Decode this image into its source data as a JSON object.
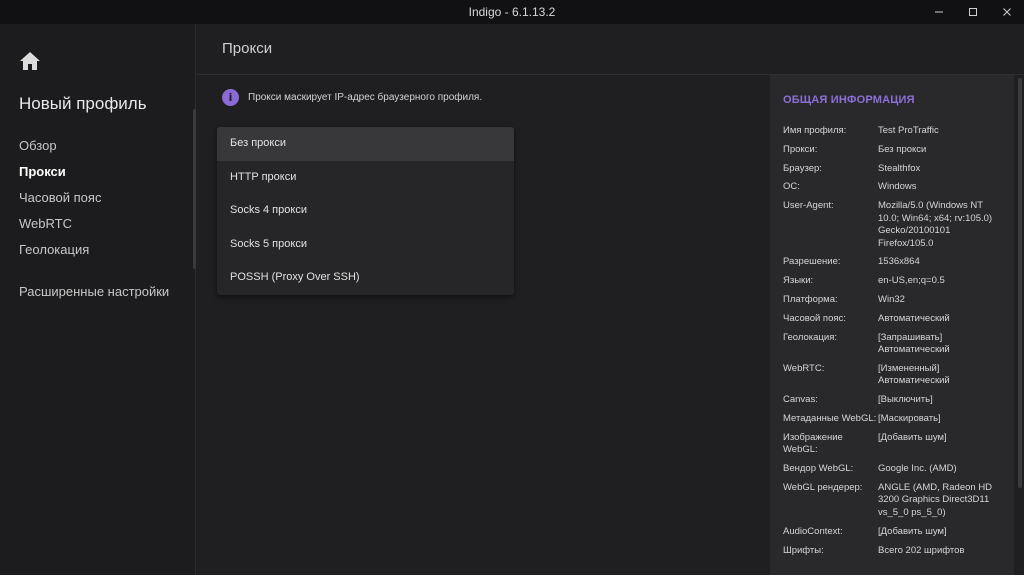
{
  "window": {
    "title": "Indigo - 6.1.13.2"
  },
  "sidebar": {
    "profile_name": "Новый профиль",
    "items": [
      {
        "label": "Обзор"
      },
      {
        "label": "Прокси"
      },
      {
        "label": "Часовой пояс"
      },
      {
        "label": "WebRTC"
      },
      {
        "label": "Геолокация"
      },
      {
        "label": "Расширенные настройки"
      }
    ],
    "active_item": "Прокси"
  },
  "page": {
    "title": "Прокси",
    "notice": "Прокси маскирует IP-адрес браузерного профиля."
  },
  "proxy_dropdown": {
    "selected": "Без прокси",
    "options": [
      "Без прокси",
      "HTTP прокси",
      "Socks 4 прокси",
      "Socks 5 прокси",
      "POSSH (Proxy Over SSH)"
    ]
  },
  "info_panel": {
    "heading": "ОБЩАЯ ИНФОРМАЦИЯ",
    "rows": [
      {
        "key": "Имя профиля:",
        "value": "Test ProTraffic"
      },
      {
        "key": "Прокси:",
        "value": "Без прокси"
      },
      {
        "key": "Браузер:",
        "value": "Stealthfox"
      },
      {
        "key": "ОС:",
        "value": "Windows"
      },
      {
        "key": "User-Agent:",
        "value": "Mozilla/5.0 (Windows NT 10.0; Win64; x64; rv:105.0) Gecko/20100101 Firefox/105.0"
      },
      {
        "key": "Разрешение:",
        "value": "1536x864"
      },
      {
        "key": "Языки:",
        "value": "en-US,en;q=0.5"
      },
      {
        "key": "Платформа:",
        "value": "Win32"
      },
      {
        "key": "Часовой пояс:",
        "value": "Автоматический"
      },
      {
        "key": "Геолокация:",
        "value": "[Запрашивать] Автоматический"
      },
      {
        "key": "WebRTC:",
        "value": "[Измененный] Автоматический"
      },
      {
        "key": "Canvas:",
        "value": "[Выключить]"
      },
      {
        "key": "Метаданные WebGL:",
        "value": "[Маскировать]"
      },
      {
        "key": "Изображение WebGL:",
        "value": "[Добавить шум]"
      },
      {
        "key": "Вендор WebGL:",
        "value": "Google Inc. (AMD)"
      },
      {
        "key": "WebGL рендерер:",
        "value": "ANGLE (AMD, Radeon HD 3200 Graphics Direct3D11 vs_5_0 ps_5_0)"
      },
      {
        "key": "AudioContext:",
        "value": "[Добавить шум]"
      },
      {
        "key": "Шрифты:",
        "value": "Всего 202 шрифтов"
      }
    ]
  },
  "colors": {
    "accent": "#8d6fd8",
    "background": "#1f1f21",
    "panel": "#29292b"
  },
  "icons": {
    "home": "home-icon",
    "info": "info-icon",
    "minimize": "minimize-icon",
    "maximize": "maximize-icon",
    "close": "close-icon"
  }
}
